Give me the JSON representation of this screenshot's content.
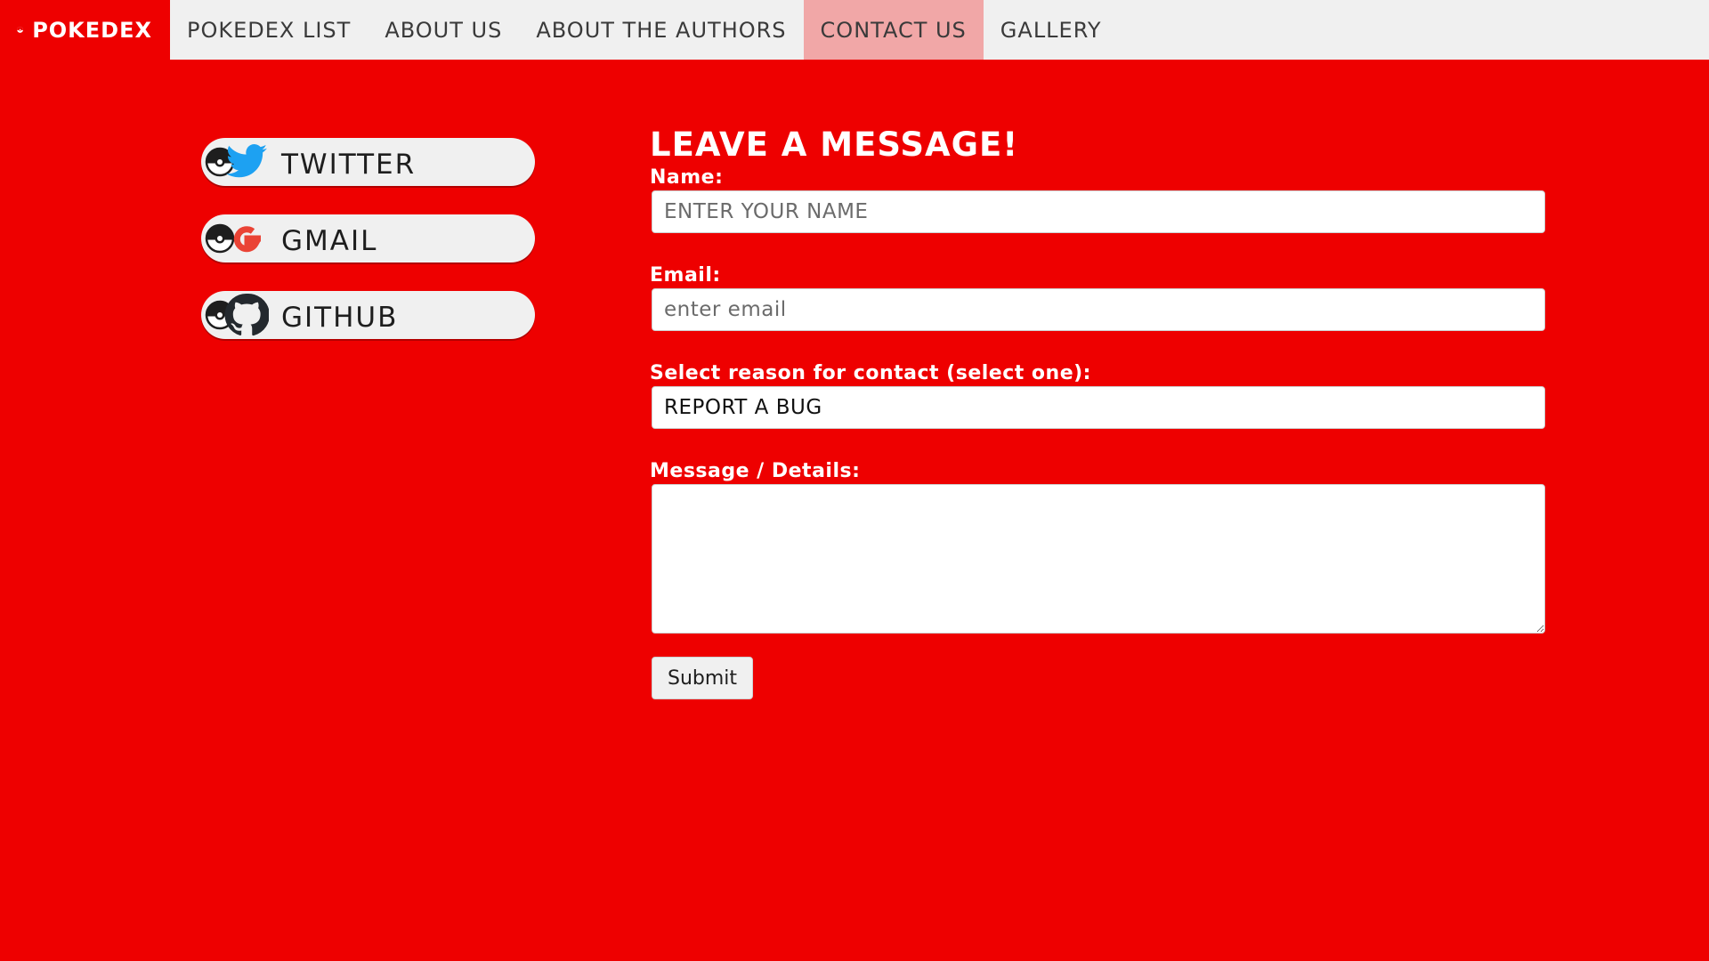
{
  "nav": {
    "brand_label": "POKEDEX",
    "brand_icon": "pokeball-icon",
    "links": [
      {
        "label": "POKEDEX LIST",
        "active": false
      },
      {
        "label": "ABOUT US",
        "active": false
      },
      {
        "label": "ABOUT THE AUTHORS",
        "active": false
      },
      {
        "label": "CONTACT US",
        "active": true
      },
      {
        "label": "GALLERY",
        "active": false
      }
    ]
  },
  "social": [
    {
      "label": "TWITTER",
      "icon": "twitter-icon"
    },
    {
      "label": "GMAIL",
      "icon": "gmail-icon"
    },
    {
      "label": "GITHUB",
      "icon": "github-icon"
    }
  ],
  "form": {
    "title": "LEAVE A MESSAGE!",
    "name_label": "Name:",
    "name_placeholder": "ENTER YOUR NAME",
    "name_value": "",
    "email_label": "Email:",
    "email_placeholder": "enter email",
    "email_value": "",
    "reason_label": "Select reason for contact (select one):",
    "reason_selected": "REPORT A BUG",
    "message_label": "Message / Details:",
    "message_value": "",
    "submit_label": "Submit"
  },
  "colors": {
    "background_red": "#ee0000",
    "nav_bg": "#f0f0f0",
    "nav_active_bg": "#f1a7a7",
    "pill_bg": "#f0f0f0",
    "twitter_blue": "#1da1f2",
    "gmail_red": "#ea4335",
    "github_dark": "#24292e"
  }
}
